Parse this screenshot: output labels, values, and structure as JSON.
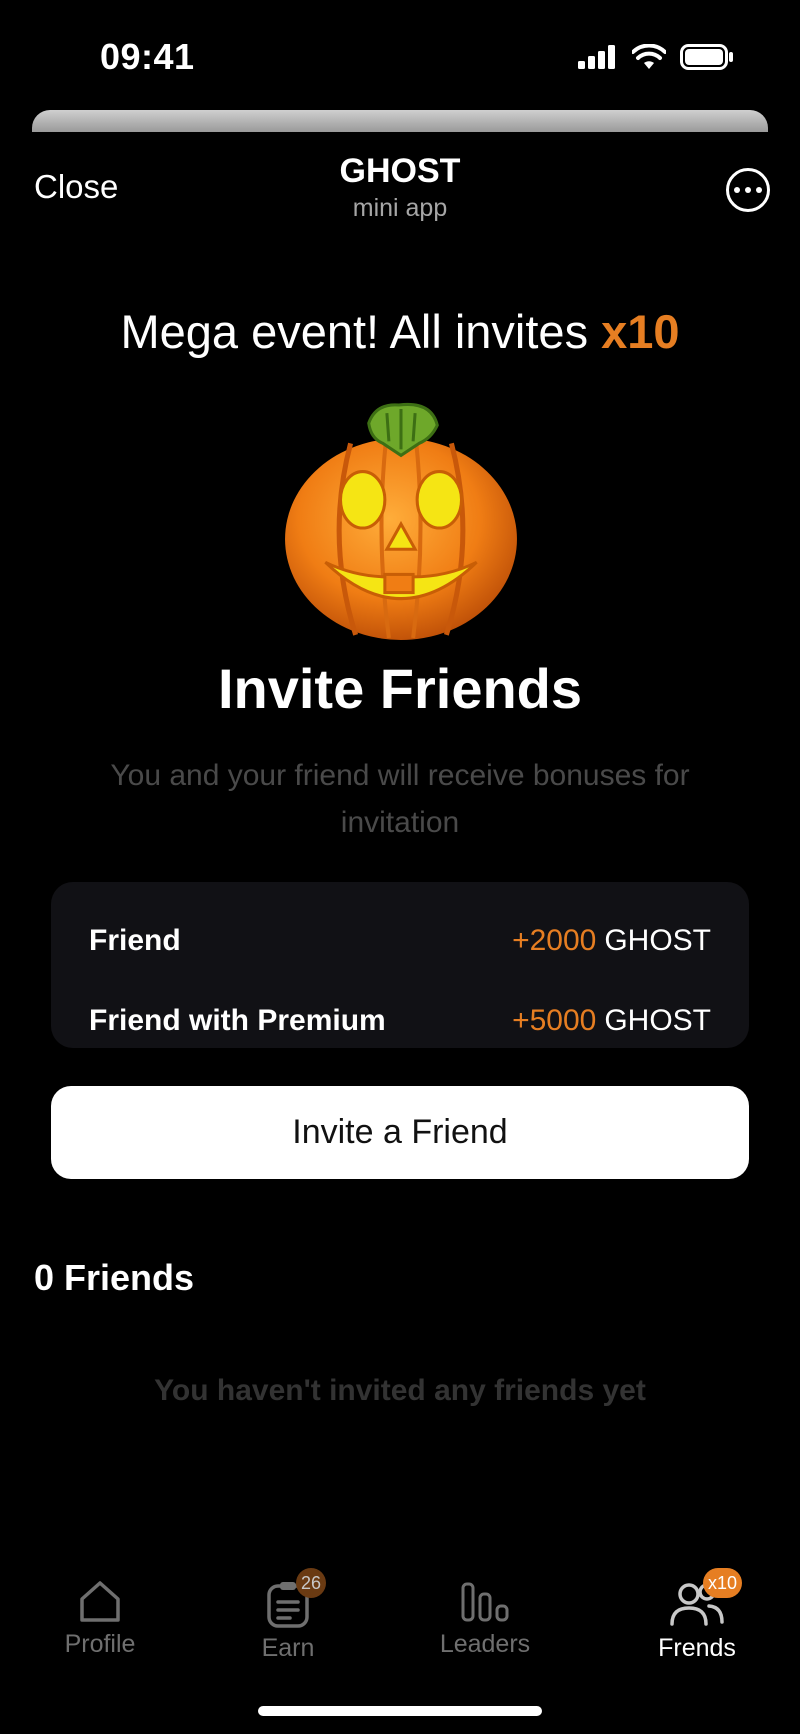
{
  "status_bar": {
    "time": "09:41"
  },
  "header": {
    "close_label": "Close",
    "title": "GHOST",
    "subtitle": "mini app"
  },
  "event": {
    "text": "Mega event! All invites ",
    "multiplier": "x10"
  },
  "invite": {
    "title": "Invite Friends",
    "description": "You and your friend will receive bonuses for invitation"
  },
  "rewards": [
    {
      "label": "Friend",
      "amount": "+2000",
      "currency": "GHOST"
    },
    {
      "label": "Friend with Premium",
      "amount": "+5000",
      "currency": "GHOST"
    }
  ],
  "invite_button": "Invite a Friend",
  "friends": {
    "count_label": "0 Friends",
    "empty_message": "You haven't invited any friends yet"
  },
  "nav": [
    {
      "label": "Profile",
      "icon": "home-icon",
      "badge": ""
    },
    {
      "label": "Earn",
      "icon": "clipboard-icon",
      "badge": "26"
    },
    {
      "label": "Leaders",
      "icon": "leaderboard-icon",
      "badge": ""
    },
    {
      "label": "Frends",
      "icon": "friends-icon",
      "badge": "x10"
    }
  ],
  "colors": {
    "accent": "#e67e22",
    "card": "#111115",
    "muted": "#4a4a4a"
  }
}
